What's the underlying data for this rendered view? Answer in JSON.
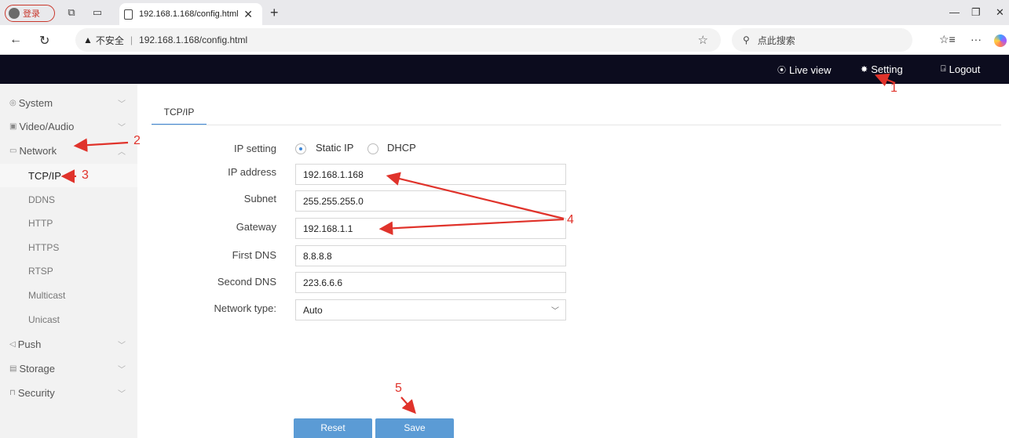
{
  "browser": {
    "profile_label": "登录",
    "tab_title": "192.168.1.168/config.html",
    "url": "192.168.1.168/config.html",
    "security_label": "不安全",
    "search_placeholder": "点此搜索"
  },
  "header": {
    "live_view": "Live view",
    "setting": "Setting",
    "logout": "Logout"
  },
  "sidebar": {
    "system": "System",
    "video_audio": "Video/Audio",
    "network": "Network",
    "tcpip": "TCP/IP",
    "ddns": "DDNS",
    "http": "HTTP",
    "https": "HTTPS",
    "rtsp": "RTSP",
    "multicast": "Multicast",
    "unicast": "Unicast",
    "push": "Push",
    "storage": "Storage",
    "security": "Security"
  },
  "content": {
    "tab": "TCP/IP",
    "ip_setting_label": "IP setting",
    "static_ip": "Static IP",
    "dhcp": "DHCP",
    "ip_address_label": "IP address",
    "ip_address": "192.168.1.168",
    "subnet_label": "Subnet",
    "subnet": "255.255.255.0",
    "gateway_label": "Gateway",
    "gateway": "192.168.1.1",
    "first_dns_label": "First DNS",
    "first_dns": "8.8.8.8",
    "second_dns_label": "Second DNS",
    "second_dns": "223.6.6.6",
    "network_type_label": "Network type:",
    "network_type": "Auto",
    "reset": "Reset",
    "save": "Save"
  },
  "annotations": {
    "n1": "1",
    "n2": "2",
    "n3": "3",
    "n4": "4",
    "n5": "5"
  },
  "colors": {
    "accent": "#3d86d6",
    "button": "#5b9bd5",
    "header_bg": "#0c0c1e",
    "annotation": "#e0332b"
  }
}
